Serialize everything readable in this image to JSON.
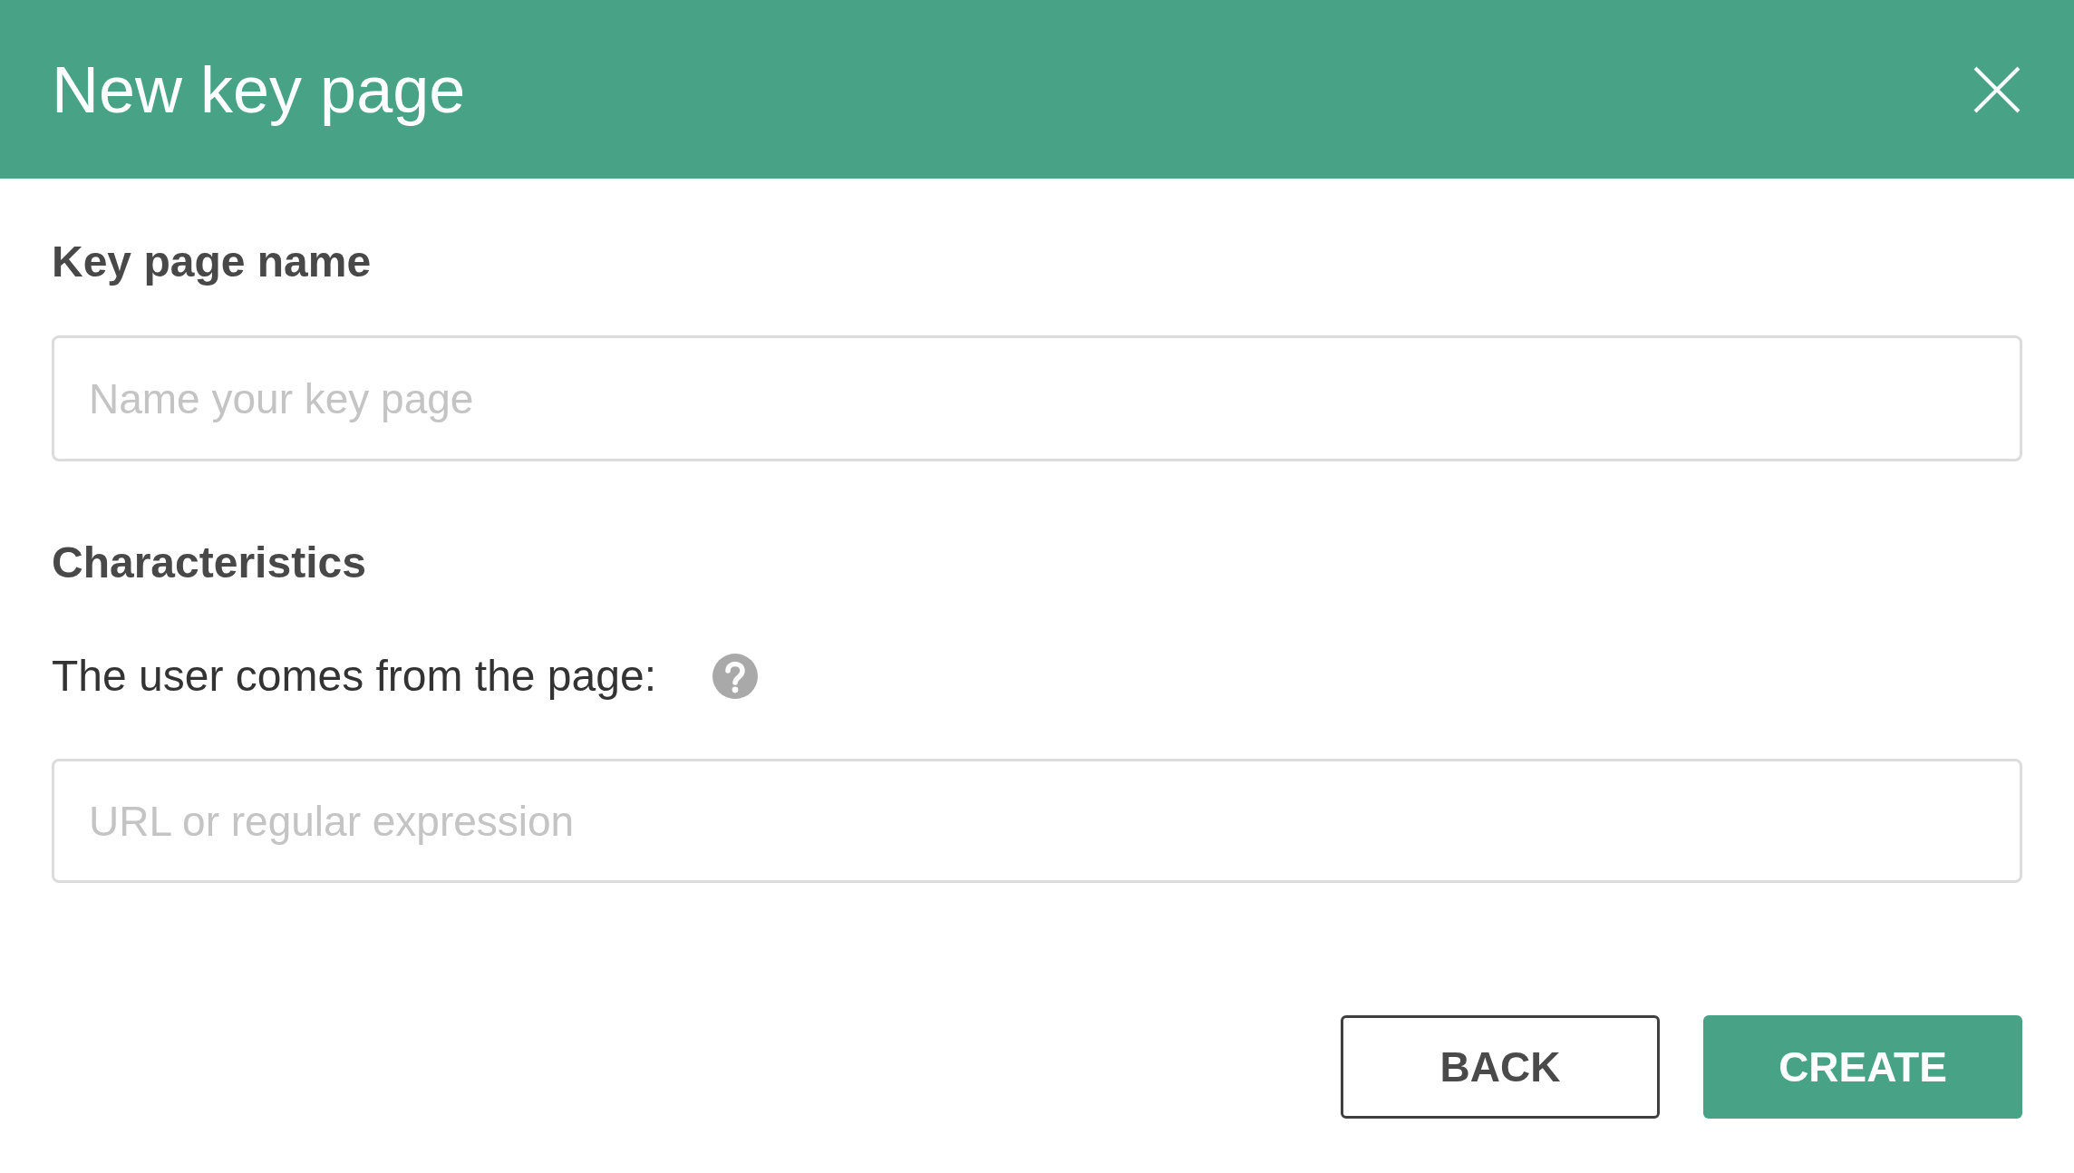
{
  "dialog": {
    "title": "New key page"
  },
  "name_section": {
    "label": "Key page name",
    "field": {
      "placeholder": "Name your key page"
    }
  },
  "characteristics": {
    "heading": "Characteristics",
    "label": "The user comes from the page:",
    "field": {
      "placeholder": "URL or regular expression"
    }
  },
  "buttons": [
    {
      "label": "BACK",
      "kind": "secondary"
    },
    {
      "label": "CREATE",
      "kind": "primary"
    }
  ]
}
